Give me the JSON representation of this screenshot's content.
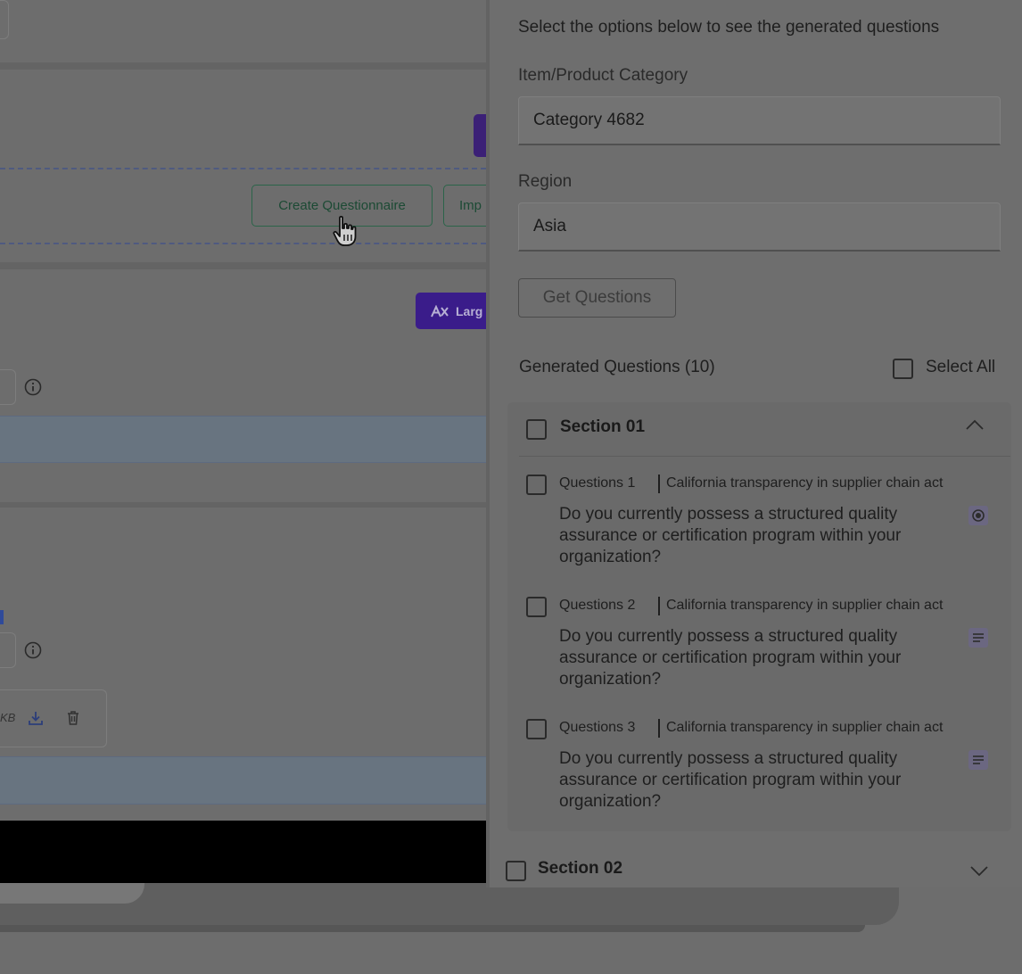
{
  "background": {
    "create_questionnaire_label": "Create Questionnaire",
    "import_label_truncated": "Imp",
    "large_button_label_truncated": "Larg",
    "file_size_fragment": "KB"
  },
  "panel": {
    "intro": "Select the options below to see the generated questions",
    "category_label": "Item/Product Category",
    "category_value": "Category 4682",
    "region_label": "Region",
    "region_value": "Asia",
    "get_questions_label": "Get Questions",
    "generated_title": "Generated Questions (10)",
    "select_all_label": "Select All"
  },
  "sections": [
    {
      "title": "Section 01",
      "expanded": true,
      "questions": [
        {
          "number": "Questions 1",
          "topic": "California transparency in supplier chain act",
          "text": "Do you currently possess a structured quality assurance or certification program within your organization?",
          "type_icon": "radio-icon"
        },
        {
          "number": "Questions 2",
          "topic": "California transparency in supplier chain act",
          "text": "Do you currently possess a structured quality assurance or certification program within your organization?",
          "type_icon": "text-lines-icon"
        },
        {
          "number": "Questions 3",
          "topic": "California transparency in supplier chain act",
          "text": "Do you currently possess a structured quality assurance or certification program within your organization?",
          "type_icon": "text-lines-icon"
        }
      ]
    },
    {
      "title": "Section 02",
      "expanded": false
    }
  ],
  "colors": {
    "overlay_gray": "#6e6e6e",
    "accent_purple": "#3a1c8a",
    "accent_green": "#2b6449"
  }
}
